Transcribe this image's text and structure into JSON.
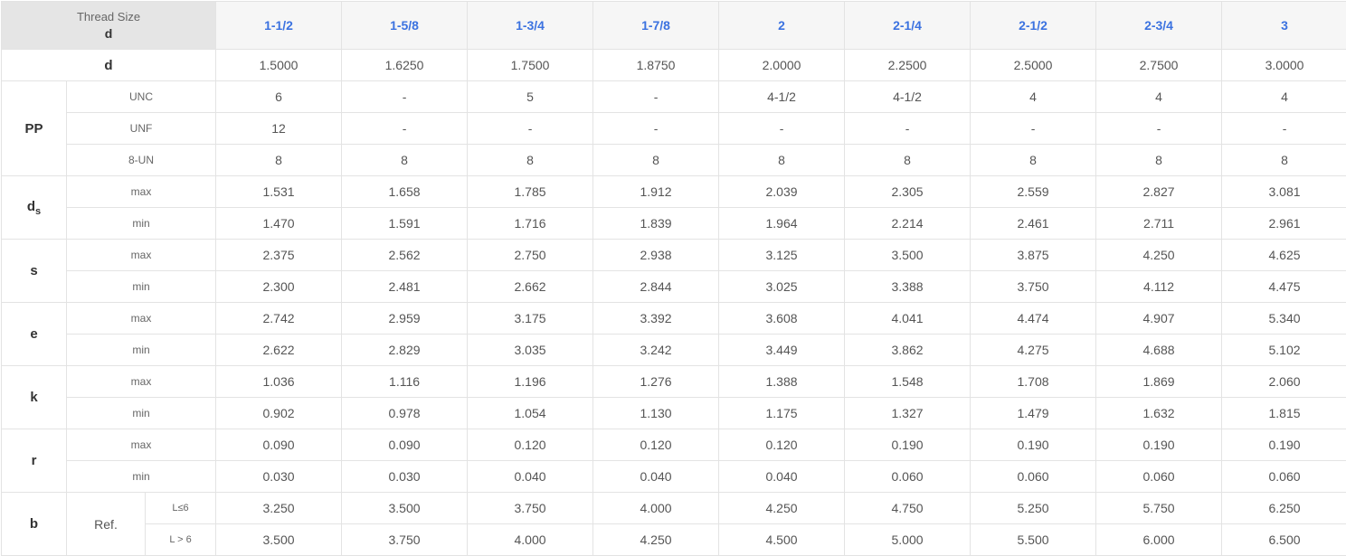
{
  "header": {
    "corner_top": "Thread Size",
    "corner_bottom": "d",
    "sizes": [
      "1-1/2",
      "1-5/8",
      "1-3/4",
      "1-7/8",
      "2",
      "2-1/4",
      "2-1/2",
      "2-3/4",
      "3"
    ]
  },
  "rows": {
    "d": {
      "label": "d",
      "values": [
        "1.5000",
        "1.6250",
        "1.7500",
        "1.8750",
        "2.0000",
        "2.2500",
        "2.5000",
        "2.7500",
        "3.0000"
      ]
    },
    "pp": {
      "label": "PP",
      "unc": {
        "label": "UNC",
        "values": [
          "6",
          "-",
          "5",
          "-",
          "4-1/2",
          "4-1/2",
          "4",
          "4",
          "4"
        ]
      },
      "unf": {
        "label": "UNF",
        "values": [
          "12",
          "-",
          "-",
          "-",
          "-",
          "-",
          "-",
          "-",
          "-"
        ]
      },
      "un8": {
        "label": "8-UN",
        "values": [
          "8",
          "8",
          "8",
          "8",
          "8",
          "8",
          "8",
          "8",
          "8"
        ]
      }
    },
    "ds": {
      "label": "d",
      "label_sub": "s",
      "max": {
        "label": "max",
        "values": [
          "1.531",
          "1.658",
          "1.785",
          "1.912",
          "2.039",
          "2.305",
          "2.559",
          "2.827",
          "3.081"
        ]
      },
      "min": {
        "label": "min",
        "values": [
          "1.470",
          "1.591",
          "1.716",
          "1.839",
          "1.964",
          "2.214",
          "2.461",
          "2.711",
          "2.961"
        ]
      }
    },
    "s": {
      "label": "s",
      "max": {
        "label": "max",
        "values": [
          "2.375",
          "2.562",
          "2.750",
          "2.938",
          "3.125",
          "3.500",
          "3.875",
          "4.250",
          "4.625"
        ]
      },
      "min": {
        "label": "min",
        "values": [
          "2.300",
          "2.481",
          "2.662",
          "2.844",
          "3.025",
          "3.388",
          "3.750",
          "4.112",
          "4.475"
        ]
      }
    },
    "e": {
      "label": "e",
      "max": {
        "label": "max",
        "values": [
          "2.742",
          "2.959",
          "3.175",
          "3.392",
          "3.608",
          "4.041",
          "4.474",
          "4.907",
          "5.340"
        ]
      },
      "min": {
        "label": "min",
        "values": [
          "2.622",
          "2.829",
          "3.035",
          "3.242",
          "3.449",
          "3.862",
          "4.275",
          "4.688",
          "5.102"
        ]
      }
    },
    "k": {
      "label": "k",
      "max": {
        "label": "max",
        "values": [
          "1.036",
          "1.116",
          "1.196",
          "1.276",
          "1.388",
          "1.548",
          "1.708",
          "1.869",
          "2.060"
        ]
      },
      "min": {
        "label": "min",
        "values": [
          "0.902",
          "0.978",
          "1.054",
          "1.130",
          "1.175",
          "1.327",
          "1.479",
          "1.632",
          "1.815"
        ]
      }
    },
    "r": {
      "label": "r",
      "max": {
        "label": "max",
        "values": [
          "0.090",
          "0.090",
          "0.120",
          "0.120",
          "0.120",
          "0.190",
          "0.190",
          "0.190",
          "0.190"
        ]
      },
      "min": {
        "label": "min",
        "values": [
          "0.030",
          "0.030",
          "0.040",
          "0.040",
          "0.040",
          "0.060",
          "0.060",
          "0.060",
          "0.060"
        ]
      }
    },
    "b": {
      "label": "b",
      "ref_label": "Ref.",
      "le6": {
        "label": "L≤6",
        "values": [
          "3.250",
          "3.500",
          "3.750",
          "4.000",
          "4.250",
          "4.750",
          "5.250",
          "5.750",
          "6.250"
        ]
      },
      "gt6": {
        "label": "L > 6",
        "values": [
          "3.500",
          "3.750",
          "4.000",
          "4.250",
          "4.500",
          "5.000",
          "5.500",
          "6.000",
          "6.500"
        ]
      }
    }
  },
  "colors": {
    "header_accent": "#3b72e0",
    "corner_bg": "#e5e5e5",
    "border": "#e3e3e3"
  }
}
